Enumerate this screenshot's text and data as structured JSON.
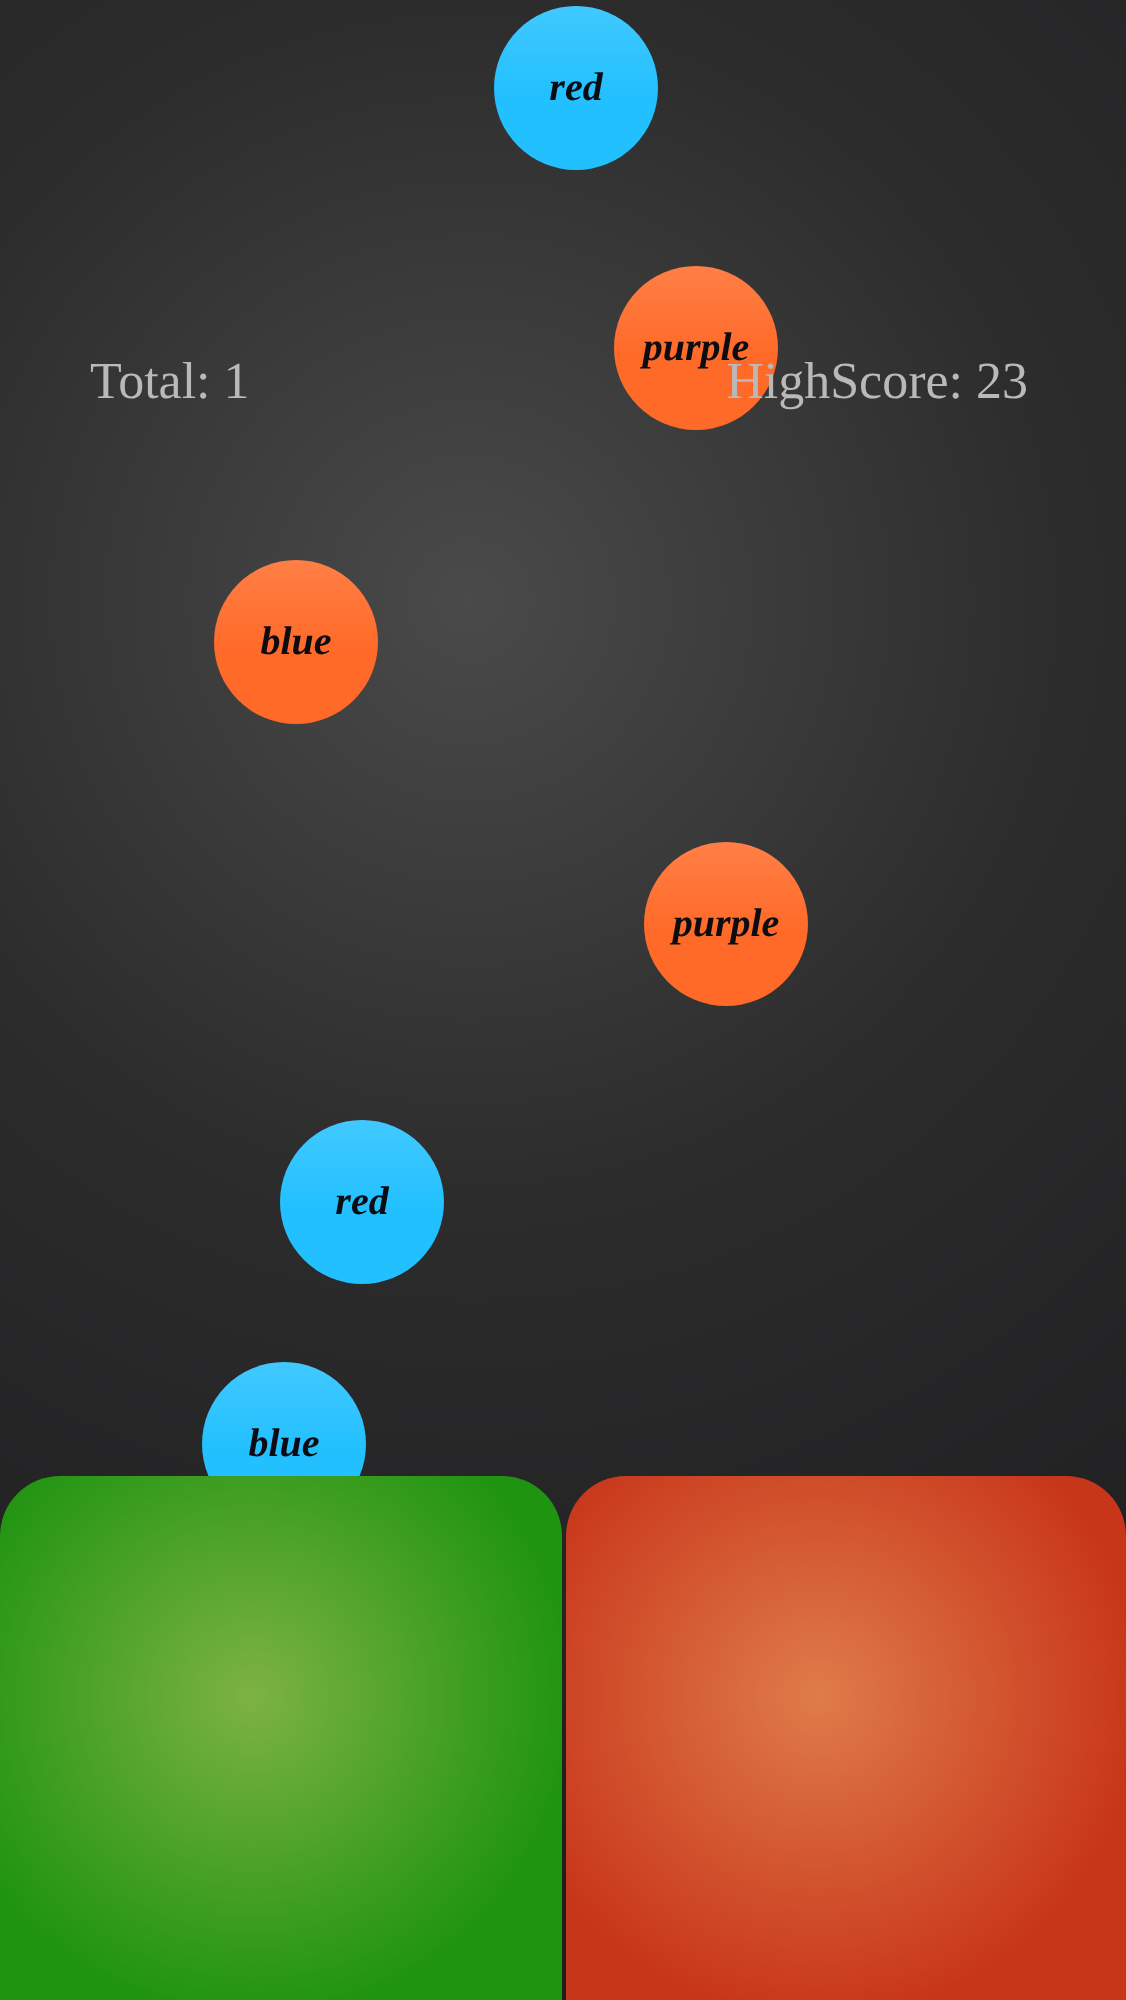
{
  "scores": {
    "total": "Total: 1",
    "high_score": "HighScore: 23"
  },
  "balls": [
    {
      "label": "red",
      "color": "#22c0ff"
    },
    {
      "label": "purple",
      "color": "#ff6a28"
    },
    {
      "label": "blue",
      "color": "#ff6a28"
    },
    {
      "label": "purple",
      "color": "#ff6a28"
    },
    {
      "label": "red",
      "color": "#22c0ff"
    },
    {
      "label": "blue",
      "color": "#22c0ff"
    }
  ],
  "pads": [
    {
      "color": "#1f9410"
    },
    {
      "color": "#c8361a"
    }
  ]
}
